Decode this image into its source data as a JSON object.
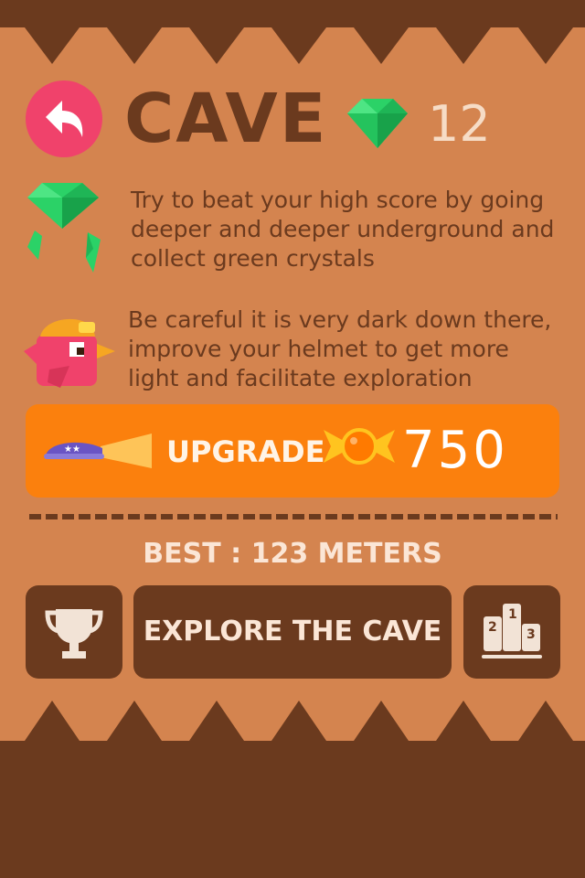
{
  "screen": {
    "title": "CAVE",
    "gem_count": "12"
  },
  "description": {
    "crystals_text": "Try to beat your high score by going deeper and deeper underground and collect green crystals",
    "helmet_text": "Be careful it is very dark down there, improve your helmet to get more light and facilitate exploration"
  },
  "upgrade": {
    "label": "UPGRADE",
    "cost": "750"
  },
  "best": {
    "text": "BEST : 123 METERS"
  },
  "actions": {
    "explore_label": "EXPLORE THE CAVE"
  },
  "icons": {
    "back": "back-arrow-icon",
    "gem": "green-gem-icon",
    "crystals": "crystals-icon",
    "bird": "helmet-bird-icon",
    "helmet": "helmet-light-icon",
    "candy": "candy-icon",
    "trophy": "trophy-icon",
    "leaderboard": "podium-icon"
  },
  "colors": {
    "panel": "#d4844f",
    "dark_brown": "#6b3a1e",
    "back_button": "#f0426b",
    "upgrade_button": "#fb800d",
    "gem_green": "#2bd267"
  }
}
